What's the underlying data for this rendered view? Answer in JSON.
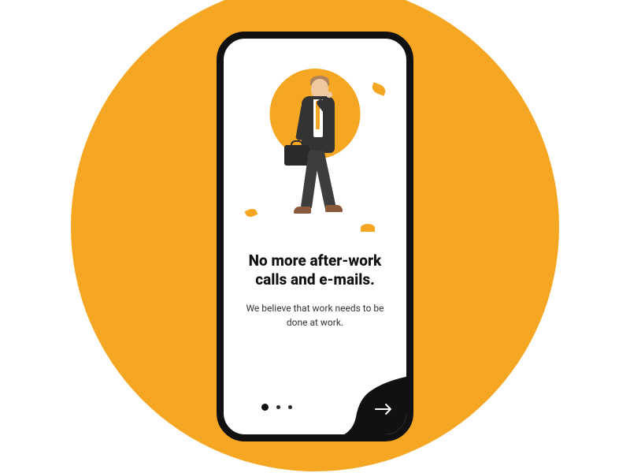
{
  "onboarding": {
    "title": "No more after-work calls and e-mails.",
    "subtitle": "We believe that work needs to be done at work.",
    "currentPage": 1,
    "totalPages": 3
  },
  "colors": {
    "accent": "#f5a623",
    "dark": "#111111"
  },
  "icons": {
    "next": "arrow-right"
  }
}
